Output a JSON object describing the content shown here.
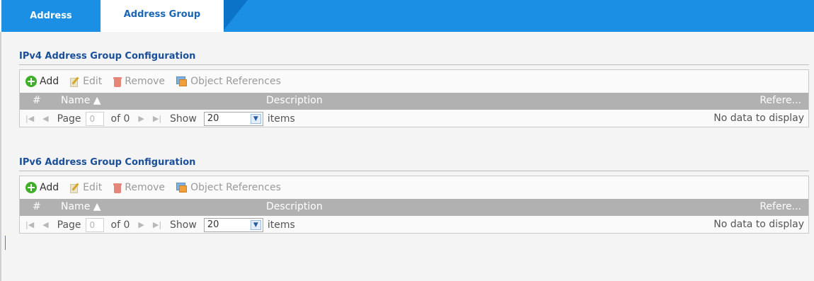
{
  "tabs": [
    {
      "label": "Address"
    },
    {
      "label": "Address Group"
    }
  ],
  "sections": [
    {
      "title": "IPv4 Address Group Configuration",
      "toolbar": {
        "add": "Add",
        "edit": "Edit",
        "remove": "Remove",
        "references": "Object References"
      },
      "columns": {
        "num": "#",
        "name": "Name ▲",
        "description": "Description",
        "references": "Refere..."
      },
      "pager": {
        "page_label": "Page",
        "page_value": "0",
        "of_label": "of 0",
        "show_label": "Show",
        "show_value": "20",
        "items_label": "items",
        "empty_message": "No data to display"
      }
    },
    {
      "title": "IPv6 Address Group Configuration",
      "toolbar": {
        "add": "Add",
        "edit": "Edit",
        "remove": "Remove",
        "references": "Object References"
      },
      "columns": {
        "num": "#",
        "name": "Name ▲",
        "description": "Description",
        "references": "Refere..."
      },
      "pager": {
        "page_label": "Page",
        "page_value": "0",
        "of_label": "of 0",
        "show_label": "Show",
        "show_value": "20",
        "items_label": "items",
        "empty_message": "No data to display"
      }
    }
  ],
  "icons": {
    "add": "plus-circle-icon",
    "edit": "edit-icon",
    "remove": "trash-icon",
    "references": "object-references-icon",
    "first": "first-page-icon",
    "prev": "prev-page-icon",
    "next": "next-page-icon",
    "last": "last-page-icon",
    "dropdown": "chevron-down-icon"
  },
  "colors": {
    "tab_bar": "#1a8fe3",
    "active_tab_text": "#1a66b5",
    "section_title": "#1a4f9a",
    "header_row": "#b1b1b1",
    "add_icon": "#3fae29"
  }
}
